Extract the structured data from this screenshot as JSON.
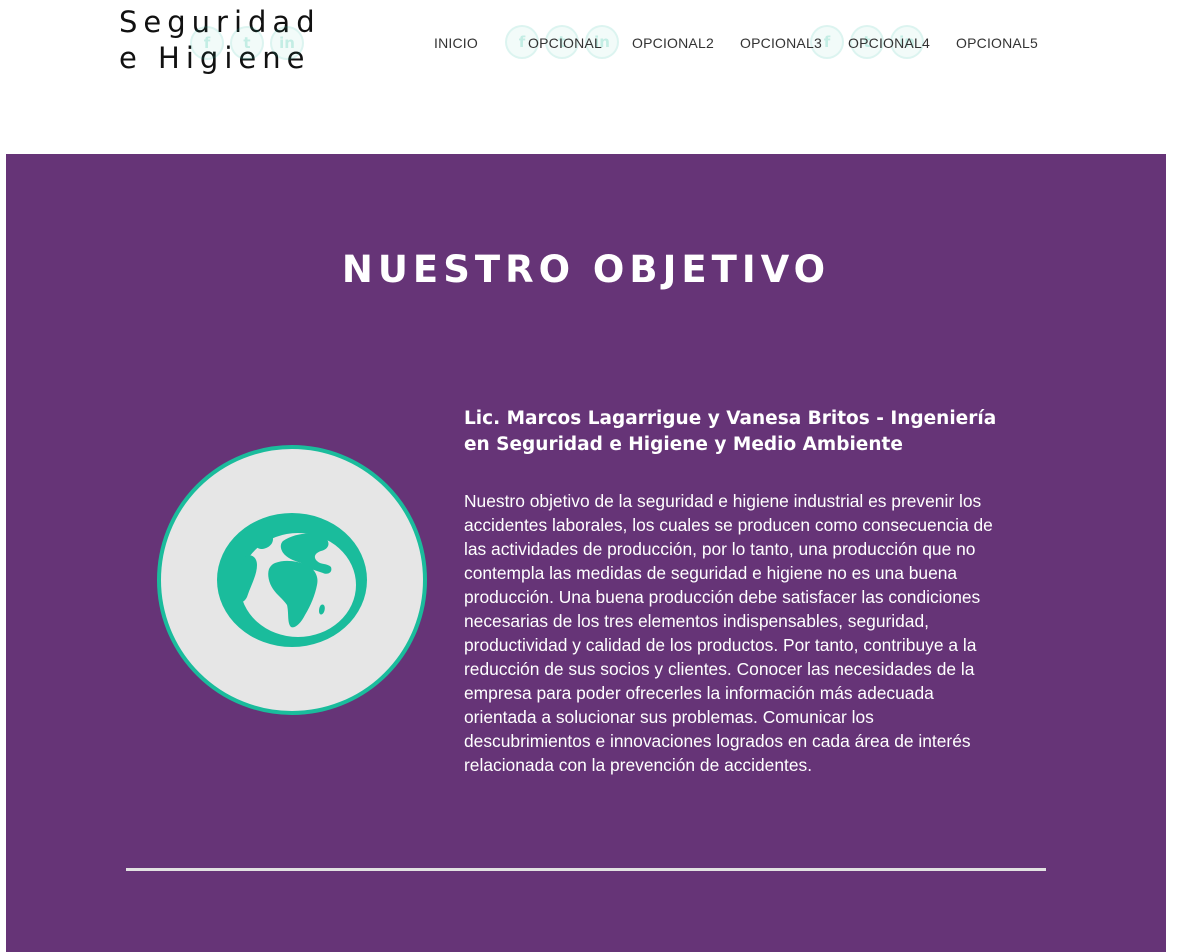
{
  "logo": {
    "line1": "Seguridad",
    "line2": "e Higiene"
  },
  "social_ghosts": [
    "f",
    "t",
    "in"
  ],
  "nav": {
    "items": [
      {
        "label": "INICIO"
      },
      {
        "label": "OPCIONAL"
      },
      {
        "label": "OPCIONAL2"
      },
      {
        "label": "OPCIONAL3"
      },
      {
        "label": "OPCIONAL4"
      },
      {
        "label": "OPCIONAL5"
      }
    ]
  },
  "objective": {
    "title": "NUESTRO OBJETIVO",
    "subtitle": "Lic. Marcos Lagarrigue y Vanesa Britos - Ingeniería en Seguridad e Higiene y Medio Ambiente",
    "body": "Nuestro objetivo de la seguridad e higiene industrial es prevenir los accidentes laborales, los cuales se producen como consecuencia de las actividades de producción, por lo tanto, una producción que no contempla las medidas de seguridad e higiene no es una buena producción. Una buena producción debe satisfacer las condiciones necesarias de los tres elementos indispensables, seguridad, productividad y calidad de los productos. Por tanto, contribuye a la reducción de sus socios y clientes. Conocer las necesidades de la empresa para poder ofrecerles la información más adecuada orientada a solucionar sus problemas. Comunicar los descubrimientos e innovaciones logrados en cada área de interés relacionada con la prevención de accidentes.",
    "icon": "globe-icon"
  },
  "colors": {
    "section_bg": "#663477",
    "accent": "#1abc9c",
    "circle_bg": "#e6e6e6",
    "divider": "#e2e2e2"
  }
}
